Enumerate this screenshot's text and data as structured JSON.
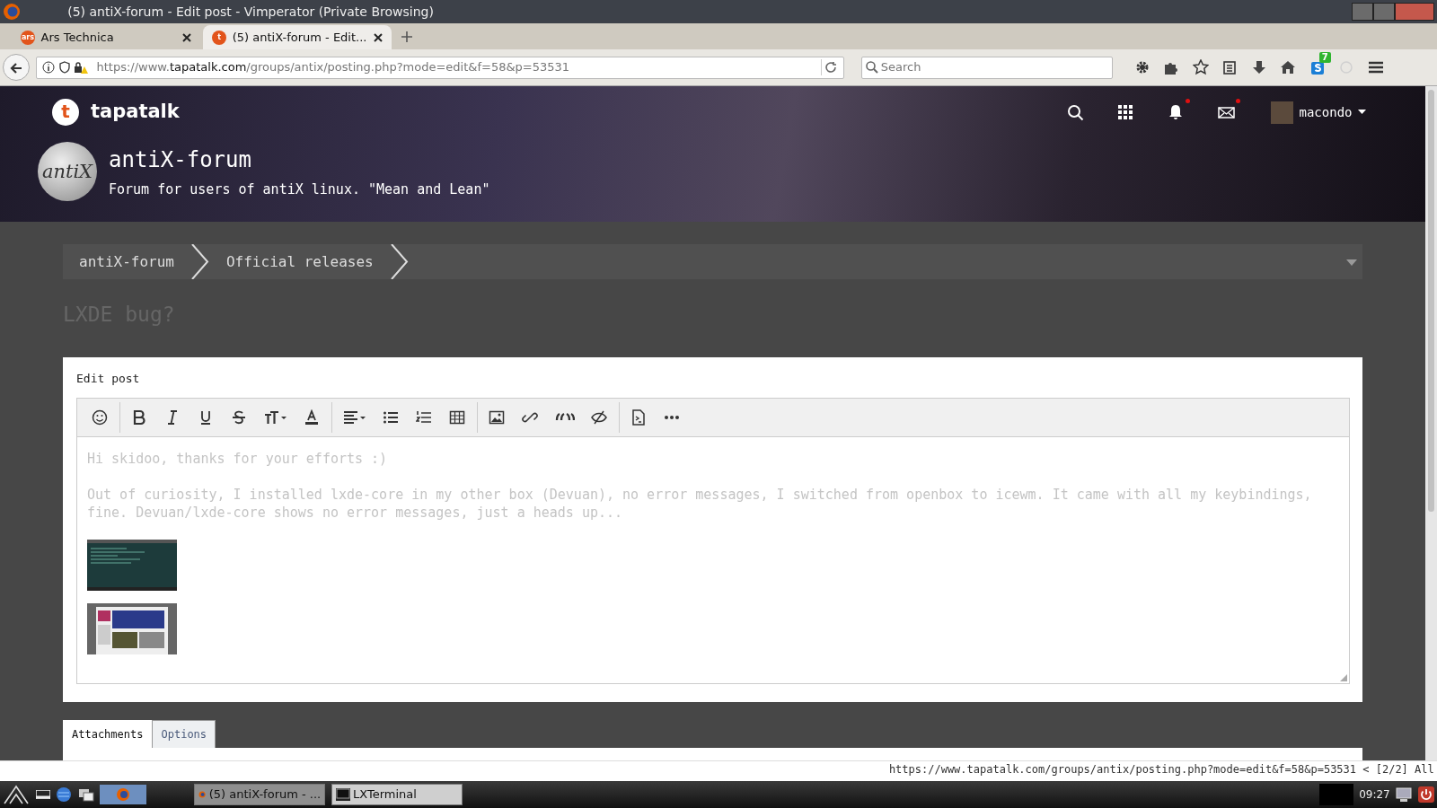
{
  "window": {
    "title": "(5) antiX-forum - Edit post - Vimperator (Private Browsing)"
  },
  "browser_tabs": [
    {
      "label": "Ars Technica",
      "icon_text": "ars",
      "selected": false
    },
    {
      "label": "(5) antiX-forum - Edit...",
      "icon_text": "t",
      "selected": true
    }
  ],
  "address_bar": {
    "scheme": "https://www.",
    "host": "tapatalk.com",
    "path": "/groups/antix/posting.php?mode=edit&f=58&p=53531"
  },
  "search_field": {
    "placeholder": "Search"
  },
  "browser_toolbar": [
    {
      "kind": "gear"
    },
    {
      "kind": "puzzle"
    },
    {
      "kind": "star"
    },
    {
      "kind": "clipboard"
    },
    {
      "kind": "download"
    },
    {
      "kind": "home"
    },
    {
      "kind": "extension",
      "badge": "7"
    },
    {
      "kind": "faded"
    },
    {
      "kind": "menu"
    }
  ],
  "site_header": {
    "logo_letter": "t",
    "brand": "tapatalk",
    "user": "macondo",
    "icons": [
      {
        "kind": "search",
        "alert": false
      },
      {
        "kind": "apps",
        "alert": false
      },
      {
        "kind": "bell",
        "alert": true
      },
      {
        "kind": "mail",
        "alert": true
      }
    ],
    "forum_logo_text": "antiX",
    "forum_name": "antiX-forum",
    "tagline": "Forum for users of antiX linux. \"Mean and Lean\""
  },
  "breadcrumbs": [
    "antiX-forum",
    "Official releases"
  ],
  "topic_title": "LXDE bug?",
  "editor": {
    "label": "Edit post",
    "toolbar_groups": [
      [
        {
          "kind": "emoji"
        }
      ],
      [
        {
          "kind": "bold"
        },
        {
          "kind": "italic"
        },
        {
          "kind": "underline"
        },
        {
          "kind": "strike"
        },
        {
          "kind": "fontsize"
        },
        {
          "kind": "color"
        }
      ],
      [
        {
          "kind": "align"
        },
        {
          "kind": "bullets"
        },
        {
          "kind": "numbers"
        },
        {
          "kind": "table"
        }
      ],
      [
        {
          "kind": "image"
        },
        {
          "kind": "link"
        },
        {
          "kind": "quote"
        },
        {
          "kind": "hide"
        }
      ],
      [
        {
          "kind": "code"
        },
        {
          "kind": "more"
        }
      ]
    ],
    "paragraphs": [
      "Hi skidoo, thanks for your efforts :)",
      "Out of curiosity, I installed lxde-core in my other box (Devuan), no error messages, I switched from openbox to icewm. It came with all my keybindings, fine. Devuan/lxde-core shows no error messages, just a heads up..."
    ],
    "attachments": [
      {
        "kind": "terminal"
      },
      {
        "kind": "webpage"
      }
    ]
  },
  "form_tabs": [
    {
      "label": "Attachments",
      "selected": true
    },
    {
      "label": "Options",
      "selected": false
    }
  ],
  "status_line": "https://www.tapatalk.com/groups/antix/posting.php?mode=edit&f=58&p=53531 < [2/2] All",
  "taskbar": {
    "windows": [
      {
        "label": "(5) antiX-forum - ...",
        "kind": "browser",
        "selected": true
      },
      {
        "label": "LXTerminal",
        "kind": "terminal",
        "selected": false
      }
    ],
    "clock": "09:27"
  }
}
